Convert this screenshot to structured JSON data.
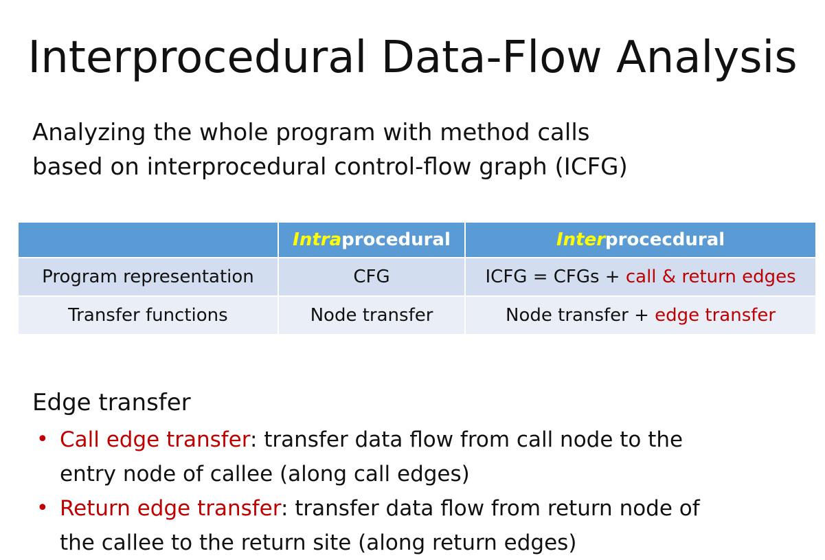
{
  "slide": {
    "title": "Interprocedural Data-Flow Analysis",
    "intro_lines": [
      "Analyzing the whole program with method calls",
      "based on interprocedural control-flow graph (ICFG)"
    ]
  },
  "table": {
    "header": {
      "col1": "",
      "intra_highlight": "Intra",
      "intra_rest": "procedural",
      "inter_highlight": "Inter",
      "inter_rest": "procecdural"
    },
    "rows": [
      {
        "label": "Program representation",
        "intra": "CFG",
        "inter_plain": "ICFG = CFGs + ",
        "inter_red": "call & return edges"
      },
      {
        "label": "Transfer functions",
        "intra": "Node transfer",
        "inter_plain": "Node transfer + ",
        "inter_red": "edge transfer"
      }
    ]
  },
  "edge_section": {
    "heading": "Edge transfer",
    "bullet_glyph": "•",
    "bullets": [
      {
        "term": "Call edge transfer",
        "line1_rest": ": transfer data flow from call node to the",
        "line2": "entry node of callee (along call edges)"
      },
      {
        "term": "Return edge transfer",
        "line1_rest": ": transfer data flow from return node of",
        "line2": "the callee to the return site (along return edges)"
      }
    ]
  },
  "colors": {
    "header_bg": "#5b9bd5",
    "row1_bg": "#d2deef",
    "row2_bg": "#eaeff7",
    "highlight": "#ffff00",
    "accent_red": "#c00000"
  }
}
